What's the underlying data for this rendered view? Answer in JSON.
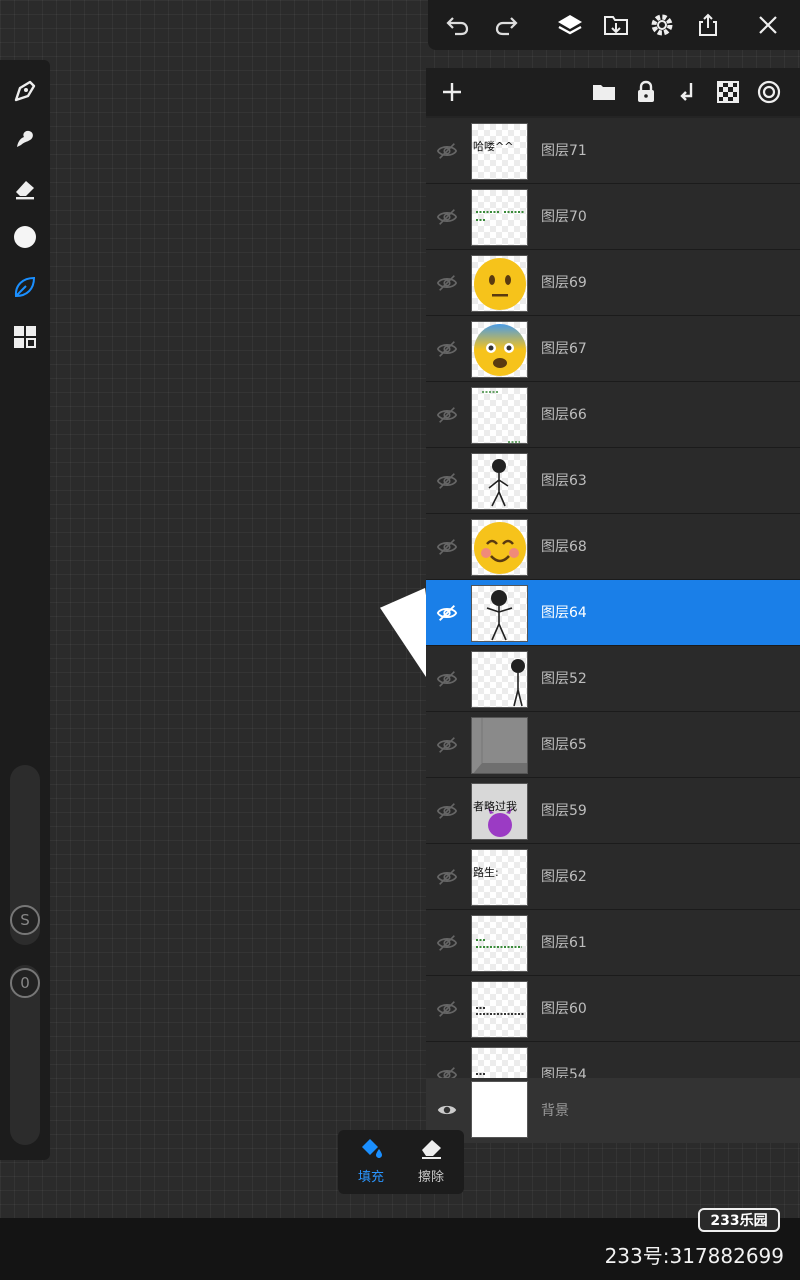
{
  "top_toolbar": {
    "icons": [
      "undo-icon",
      "redo-icon",
      "layers-icon",
      "import-icon",
      "settings-icon",
      "share-icon",
      "close-icon"
    ]
  },
  "left_toolbar": {
    "tools": [
      "pen-icon",
      "smudge-icon",
      "eraser-icon",
      "color-circle-icon",
      "leaf-brush-icon",
      "grid-panel-icon"
    ],
    "size_slider_label": "S",
    "opacity_slider_label": "0"
  },
  "layer_panel": {
    "header_icons": [
      "add-layer-icon",
      "folder-icon",
      "lock-icon",
      "merge-down-icon",
      "checker-icon",
      "target-icon"
    ],
    "layers": [
      {
        "name": "图层71",
        "thumb_text": "哈喽^^",
        "selected": false
      },
      {
        "name": "图层70",
        "thumb_text": "",
        "selected": false
      },
      {
        "name": "图层69",
        "thumb_text": "",
        "selected": false
      },
      {
        "name": "图层67",
        "thumb_text": "",
        "selected": false
      },
      {
        "name": "图层66",
        "thumb_text": "",
        "selected": false
      },
      {
        "name": "图层63",
        "thumb_text": "",
        "selected": false
      },
      {
        "name": "图层68",
        "thumb_text": "",
        "selected": false
      },
      {
        "name": "图层64",
        "thumb_text": "",
        "selected": true
      },
      {
        "name": "图层52",
        "thumb_text": "",
        "selected": false
      },
      {
        "name": "图层65",
        "thumb_text": "",
        "selected": false
      },
      {
        "name": "图层59",
        "thumb_text": "者略过我",
        "selected": false
      },
      {
        "name": "图层62",
        "thumb_text": "路生:",
        "selected": false
      },
      {
        "name": "图层61",
        "thumb_text": "",
        "selected": false
      },
      {
        "name": "图层60",
        "thumb_text": "",
        "selected": false
      },
      {
        "name": "图层54",
        "thumb_text": "",
        "selected": false
      }
    ],
    "background_layer": {
      "name": "背景"
    }
  },
  "fill_panel": {
    "fill_label": "填充",
    "erase_label": "擦除"
  },
  "watermark": {
    "logo": "233乐园",
    "text": "233号:317882699"
  },
  "colors": {
    "accent": "#1a7fe8",
    "panel_bg": "#242424",
    "canvas_bg": "#2b2b2b"
  }
}
